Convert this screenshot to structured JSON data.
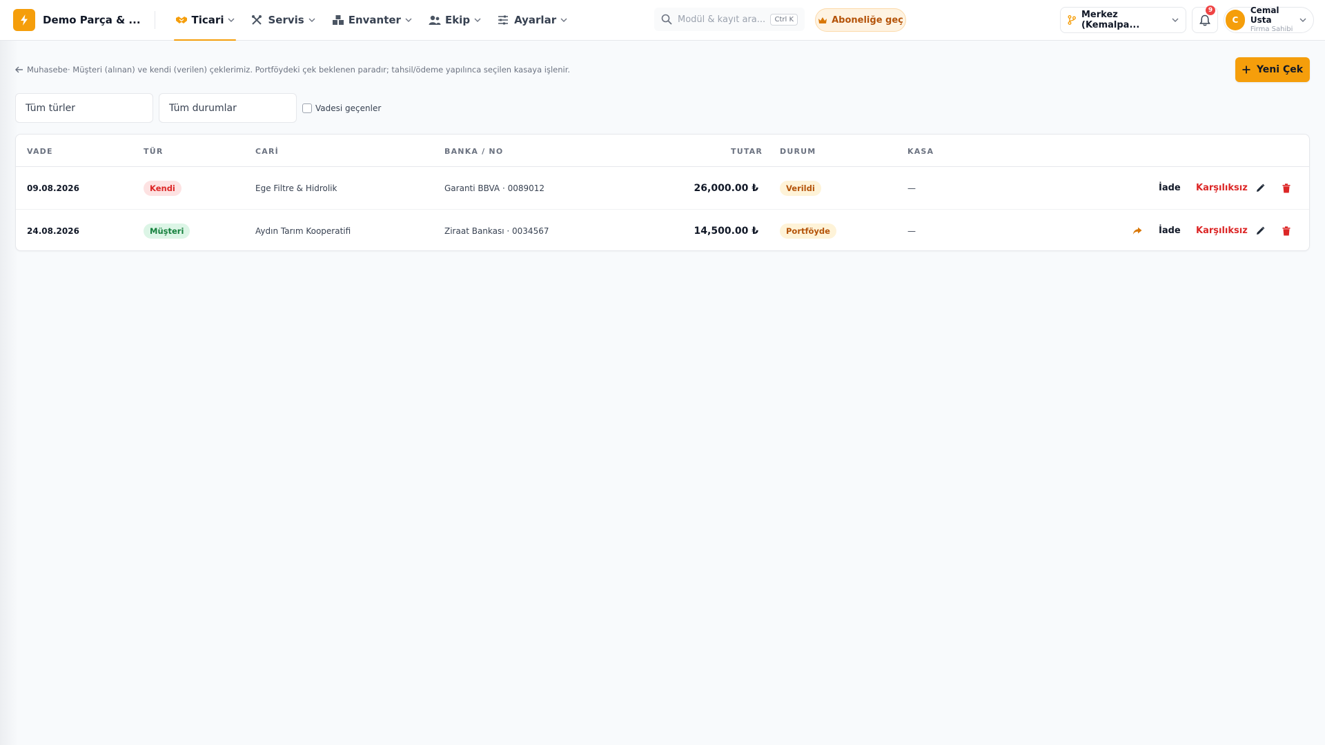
{
  "app": {
    "brand_name": "Demo Parça & ...",
    "nav": [
      {
        "label": "Ticari",
        "icon": "handshake-icon",
        "active": true
      },
      {
        "label": "Servis",
        "icon": "tools-icon",
        "active": false
      },
      {
        "label": "Envanter",
        "icon": "boxes-icon",
        "active": false
      },
      {
        "label": "Ekip",
        "icon": "users-icon",
        "active": false
      },
      {
        "label": "Ayarlar",
        "icon": "sliders-icon",
        "active": false
      }
    ],
    "search": {
      "placeholder": "Modül & kayıt ara...",
      "shortcut": "Ctrl K"
    },
    "subscribe_label": "Aboneliğe geç",
    "branch_label": "Merkez (Kemalpa...",
    "notifications_count": "9",
    "user": {
      "initial": "C",
      "name": "Cemal Usta",
      "role": "Firma Sahibi"
    }
  },
  "page": {
    "breadcrumb_link": "Muhasebe",
    "breadcrumb_text": " · Müşteri (alınan) ve kendi (verilen) çeklerimiz. Portföydeki çek beklenen paradır; tahsil/ödeme yapılınca seçilen kasaya işlenir.",
    "new_button_label": "Yeni Çek",
    "filters": {
      "type_select": "Tüm türler",
      "status_select": "Tüm durumlar",
      "overdue_checkbox_label": "Vadesi geçenler"
    },
    "table": {
      "columns": [
        "VADE",
        "TÜR",
        "CARİ",
        "BANKA / NO",
        "TUTAR",
        "DURUM",
        "KASA"
      ],
      "rows": [
        {
          "due_date": "09.08.2026",
          "type": "Kendi",
          "account": "Ege Filtre & Hidrolik",
          "bank_no": "Garanti BBVA · 0089012",
          "amount": "26,000.00 ₺",
          "status": "Verildi",
          "cash": "—",
          "show_forward": false,
          "action_return": "İade",
          "action_bounced": "Karşılıksız"
        },
        {
          "due_date": "24.08.2026",
          "type": "Müşteri",
          "account": "Aydın Tarım Kooperatifi",
          "bank_no": "Ziraat Bankası · 0034567",
          "amount": "14,500.00 ₺",
          "status": "Portföyde",
          "cash": "—",
          "show_forward": true,
          "action_return": "İade",
          "action_bounced": "Karşılıksız"
        }
      ]
    }
  },
  "colors": {
    "accent": "#f59e0b",
    "danger": "#dc2626",
    "success": "#15803d"
  }
}
